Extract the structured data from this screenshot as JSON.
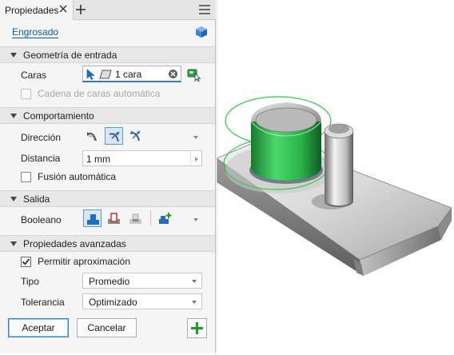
{
  "tab": {
    "title": "Propiedades"
  },
  "command": {
    "name": "Engrosado"
  },
  "sections": {
    "input": "Geometría de entrada",
    "behavior": "Comportamiento",
    "output": "Salida",
    "advanced": "Propiedades avanzadas"
  },
  "input": {
    "faces_label": "Caras",
    "faces_value": "1 cara",
    "chain_label": "Cadena de caras automática"
  },
  "behavior": {
    "direction_label": "Dirección",
    "distance_label": "Distancia",
    "distance_value": "1 mm",
    "automerge_label": "Fusión automática"
  },
  "output": {
    "boolean_label": "Booleano"
  },
  "advanced": {
    "approx_label": "Permitir aproximación",
    "type_label": "Tipo",
    "type_value": "Promedio",
    "tolerance_label": "Tolerancia",
    "tolerance_value": "Optimizado"
  },
  "buttons": {
    "ok": "Aceptar",
    "cancel": "Cancelar"
  },
  "colors": {
    "accent": "#2a7fd4",
    "link": "#0a5ea8",
    "selection_green": "#2ecc40",
    "add_green": "#1e9a2e"
  },
  "icons": [
    "close-icon",
    "plus-icon",
    "hamburger-icon",
    "cube-icon",
    "cursor-arrow-icon",
    "face-icon",
    "clear-icon",
    "face-pick-icon",
    "direction-default-icon",
    "direction-flipped-icon",
    "direction-symmetric-icon",
    "boolean-join-icon",
    "boolean-cut-icon",
    "boolean-intersect-icon",
    "new-body-icon",
    "add-icon"
  ]
}
